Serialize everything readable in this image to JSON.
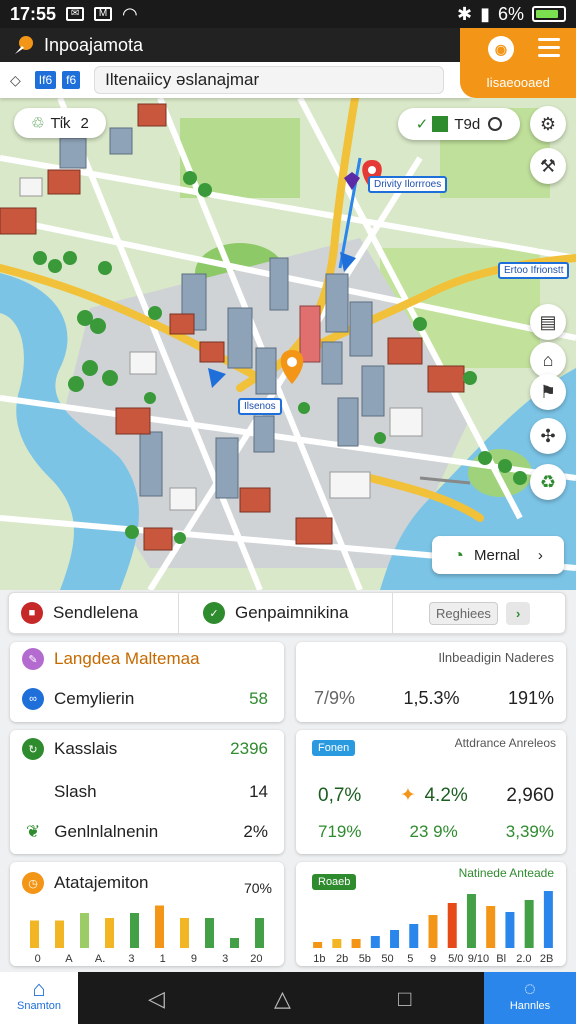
{
  "status": {
    "time": "17:55",
    "battery": "6%",
    "battery_level": 0.8
  },
  "app": {
    "title": "Inpoajamota",
    "orange_label": "Iisaeooaed"
  },
  "search": {
    "tag1": "Ιf6",
    "tag2": "f6",
    "value": "Iltenaiicy əslanajmar"
  },
  "map": {
    "chip_left": "Tΐk",
    "chip_left_num": "2",
    "chip_right": "T9d",
    "pin_label_top": "Drivity Ilorrroes",
    "pin_label_right": "Ertoo Ifrionstt",
    "pin_label_center": "Ilsenos",
    "menu_button": "Mernal"
  },
  "strip": {
    "item1": "Sendlelena",
    "item2": "Genpaimnikina",
    "item3": "Reghiees"
  },
  "card1": {
    "title": "Langdea Maltemaa",
    "row_label": "Cemylierin",
    "row_value": "58"
  },
  "card2": {
    "title": "Ilnbeadigin Naderes",
    "v1": "7/9%",
    "v2": "1,5.3%",
    "v3": "191%"
  },
  "card3": {
    "rows": [
      {
        "label": "Kasslais",
        "value": "2396"
      },
      {
        "label": "Slash",
        "value": "14"
      },
      {
        "label": "Genlnlalnenin",
        "value": "2%"
      }
    ]
  },
  "card4": {
    "badge": "Fonen",
    "title": "Attdrance Anreleos",
    "r1": [
      "0,7%",
      "4.2%",
      "2,960"
    ],
    "r2": [
      "719%",
      "23 9%",
      "3,39%"
    ]
  },
  "card5": {
    "title": "Atatajemiton",
    "pct": "70%",
    "ticks": [
      "0",
      "A",
      "A.",
      "3",
      "1",
      "9",
      "3",
      "20"
    ]
  },
  "card6": {
    "badge": "Roaeb",
    "title": "Natinede Anteade",
    "ticks": [
      "1b",
      "2b",
      "5b",
      "50",
      "5",
      "9",
      "5/0",
      "9/10",
      "Bl",
      "2.0",
      "2B"
    ]
  },
  "nav": {
    "home": "Snamton",
    "right": "Hannles"
  },
  "chart_data": [
    {
      "type": "bar",
      "values": [
        0.55,
        0.55,
        0.7,
        0.6,
        0.7,
        0.85,
        0.6,
        0.6,
        0.2,
        0.6
      ],
      "colors": [
        "#f2b624",
        "#f2b624",
        "#9ccc65",
        "#f2b624",
        "#43a047",
        "#f39517",
        "#f2b624",
        "#43a047",
        "#43a047",
        "#43a047"
      ]
    },
    {
      "type": "bar",
      "values": [
        0.1,
        0.15,
        0.15,
        0.2,
        0.3,
        0.4,
        0.55,
        0.75,
        0.9,
        0.7,
        0.6,
        0.8,
        0.95
      ],
      "colors": [
        "#f39517",
        "#f2b624",
        "#f39517",
        "#2a86ea",
        "#2a86ea",
        "#2a86ea",
        "#f39517",
        "#e64a19",
        "#43a047",
        "#f39517",
        "#2a86ea",
        "#43a047",
        "#2a86ea"
      ]
    }
  ]
}
